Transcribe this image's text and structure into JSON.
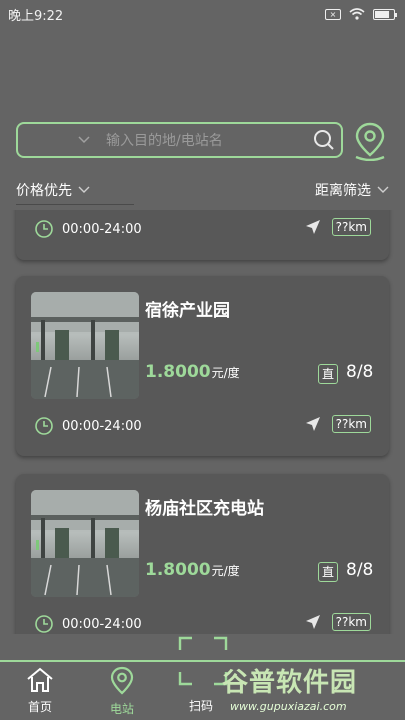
{
  "status_bar": {
    "time": "晚上9:22",
    "sim_label": "×"
  },
  "search": {
    "placeholder": "输入目的地/电站名"
  },
  "filters": {
    "price_label": "价格优先",
    "distance_label": "距离筛选"
  },
  "stations": [
    {
      "title": "",
      "price": "",
      "unit": "",
      "direct_label": "",
      "slots": "",
      "hours": "00:00-24:00",
      "distance": "??km"
    },
    {
      "title": "宿徐产业园",
      "price": "1.8000",
      "unit": "元/度",
      "direct_label": "直",
      "slots": "8/8",
      "hours": "00:00-24:00",
      "distance": "??km"
    },
    {
      "title": "杨庙社区充电站",
      "price": "1.8000",
      "unit": "元/度",
      "direct_label": "直",
      "slots": "8/8",
      "hours": "00:00-24:00",
      "distance": "??km"
    }
  ],
  "tabbar": {
    "home": "首页",
    "station": "电站",
    "scan": "扫码"
  },
  "watermark": {
    "title": "谷普软件园",
    "url": "www.gupuxiazai.com"
  },
  "colors": {
    "accent": "#9ed99a",
    "background": "#646464",
    "card": "#585858"
  }
}
